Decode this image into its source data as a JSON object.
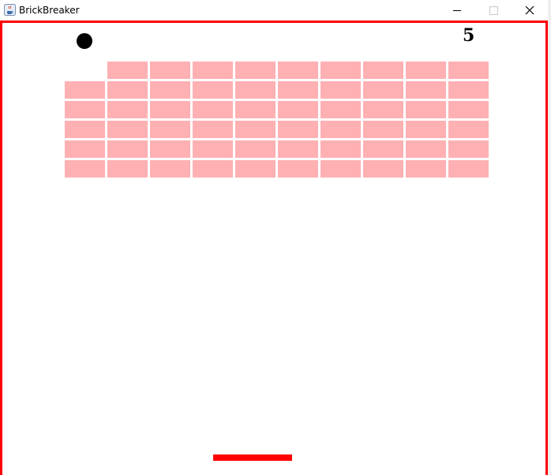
{
  "window": {
    "title": "BrickBreaker",
    "app_icon": "java-cup-icon",
    "controls": [
      "minimize-icon",
      "maximize-icon",
      "close-icon"
    ]
  },
  "game": {
    "score": "5",
    "colors": {
      "border": "#ff0000",
      "paddle": "#ff0000",
      "ball": "#000000",
      "brick": "#ffb0b3",
      "background": "#ffffff"
    },
    "brick_grid": {
      "rows": 6,
      "columns": 10,
      "layout": [
        [
          0,
          1,
          1,
          1,
          1,
          1,
          1,
          1,
          1,
          1
        ],
        [
          1,
          1,
          1,
          1,
          1,
          1,
          1,
          1,
          1,
          1
        ],
        [
          1,
          1,
          1,
          1,
          1,
          1,
          1,
          1,
          1,
          1
        ],
        [
          1,
          1,
          1,
          1,
          1,
          1,
          1,
          1,
          1,
          1
        ],
        [
          1,
          1,
          1,
          1,
          1,
          1,
          1,
          1,
          1,
          1
        ],
        [
          1,
          1,
          1,
          1,
          1,
          1,
          1,
          1,
          1,
          1
        ]
      ]
    }
  }
}
